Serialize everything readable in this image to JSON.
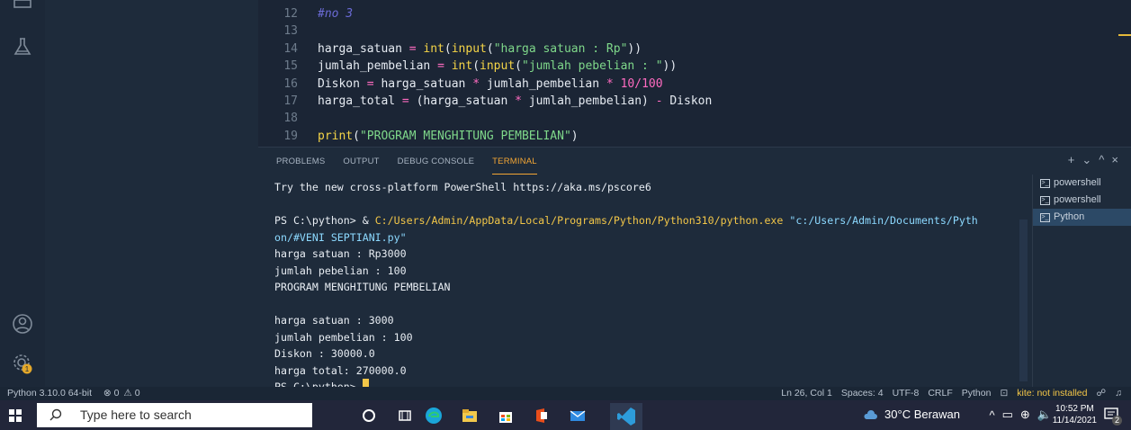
{
  "editor": {
    "lines": [
      {
        "n": "12",
        "parts": [
          {
            "t": "#no 3",
            "c": "cm"
          }
        ]
      },
      {
        "n": "13",
        "parts": []
      },
      {
        "n": "14",
        "parts": [
          {
            "t": "harga_satuan ",
            "c": ""
          },
          {
            "t": "=",
            "c": "op"
          },
          {
            "t": " ",
            "c": ""
          },
          {
            "t": "int",
            "c": "kw-fn"
          },
          {
            "t": "(",
            "c": ""
          },
          {
            "t": "input",
            "c": "kw-fn"
          },
          {
            "t": "(",
            "c": ""
          },
          {
            "t": "\"harga satuan : Rp\"",
            "c": "str"
          },
          {
            "t": "))",
            "c": ""
          }
        ]
      },
      {
        "n": "15",
        "parts": [
          {
            "t": "jumlah_pembelian ",
            "c": ""
          },
          {
            "t": "=",
            "c": "op"
          },
          {
            "t": " ",
            "c": ""
          },
          {
            "t": "int",
            "c": "kw-fn"
          },
          {
            "t": "(",
            "c": ""
          },
          {
            "t": "input",
            "c": "kw-fn"
          },
          {
            "t": "(",
            "c": ""
          },
          {
            "t": "\"jumlah pebelian : \"",
            "c": "str"
          },
          {
            "t": "))",
            "c": ""
          }
        ]
      },
      {
        "n": "16",
        "parts": [
          {
            "t": "Diskon ",
            "c": ""
          },
          {
            "t": "=",
            "c": "op"
          },
          {
            "t": " harga_satuan ",
            "c": ""
          },
          {
            "t": "*",
            "c": "op"
          },
          {
            "t": " jumlah_pembelian ",
            "c": ""
          },
          {
            "t": "*",
            "c": "op"
          },
          {
            "t": " ",
            "c": ""
          },
          {
            "t": "10",
            "c": "num"
          },
          {
            "t": "/",
            "c": "op"
          },
          {
            "t": "100",
            "c": "num"
          }
        ]
      },
      {
        "n": "17",
        "parts": [
          {
            "t": "harga_total ",
            "c": ""
          },
          {
            "t": "=",
            "c": "op"
          },
          {
            "t": " (harga_satuan ",
            "c": ""
          },
          {
            "t": "*",
            "c": "op"
          },
          {
            "t": " jumlah_pembelian) ",
            "c": ""
          },
          {
            "t": "-",
            "c": "op"
          },
          {
            "t": " Diskon",
            "c": ""
          }
        ]
      },
      {
        "n": "18",
        "parts": []
      },
      {
        "n": "19",
        "parts": [
          {
            "t": "print",
            "c": "kw-fn"
          },
          {
            "t": "(",
            "c": ""
          },
          {
            "t": "\"PROGRAM MENGHITUNG PEMBELIAN\"",
            "c": "str"
          },
          {
            "t": ")",
            "c": ""
          }
        ]
      }
    ]
  },
  "panel": {
    "tabs": [
      "PROBLEMS",
      "OUTPUT",
      "DEBUG CONSOLE",
      "TERMINAL"
    ],
    "active_tab": "TERMINAL",
    "actions": {
      "add": "+",
      "dropdown": "⌄",
      "maximize": "^",
      "close": "×"
    }
  },
  "terminal": {
    "line1": "Try the new cross-platform PowerShell https://aka.ms/pscore6",
    "prompt_prefix": "PS C:\\python> & ",
    "exe_path": "C:/Users/Admin/AppData/Local/Programs/Python/Python310/python.exe",
    "script_path_a": "\"c:/Users/Admin/Documents/Pyth",
    "script_path_b": "on/#VENI SEPTIANI.py\"",
    "out": [
      "harga satuan : Rp3000",
      "jumlah pebelian : 100",
      "PROGRAM MENGHITUNG PEMBELIAN",
      "",
      "harga satuan : 3000",
      "jumlah pembelian : 100",
      "Diskon : 30000.0",
      "harga total: 270000.0"
    ],
    "last_prompt": "PS C:\\python> ",
    "instances": [
      {
        "label": "powershell",
        "selected": false
      },
      {
        "label": "powershell",
        "selected": false
      },
      {
        "label": "Python",
        "selected": true
      }
    ]
  },
  "status": {
    "python_version": "Python 3.10.0 64-bit",
    "errors": "⊗ 0",
    "warnings": "⚠ 0",
    "ln_col": "Ln 26, Col 1",
    "spaces": "Spaces: 4",
    "encoding": "UTF-8",
    "eol": "CRLF",
    "language": "Python",
    "kite": "kite: not installed"
  },
  "taskbar": {
    "search_placeholder": "Type here to search",
    "weather": "30°C Berawan",
    "time": "10:52 PM",
    "date": "11/14/2021",
    "notif_count": "2",
    "badge": "1"
  }
}
